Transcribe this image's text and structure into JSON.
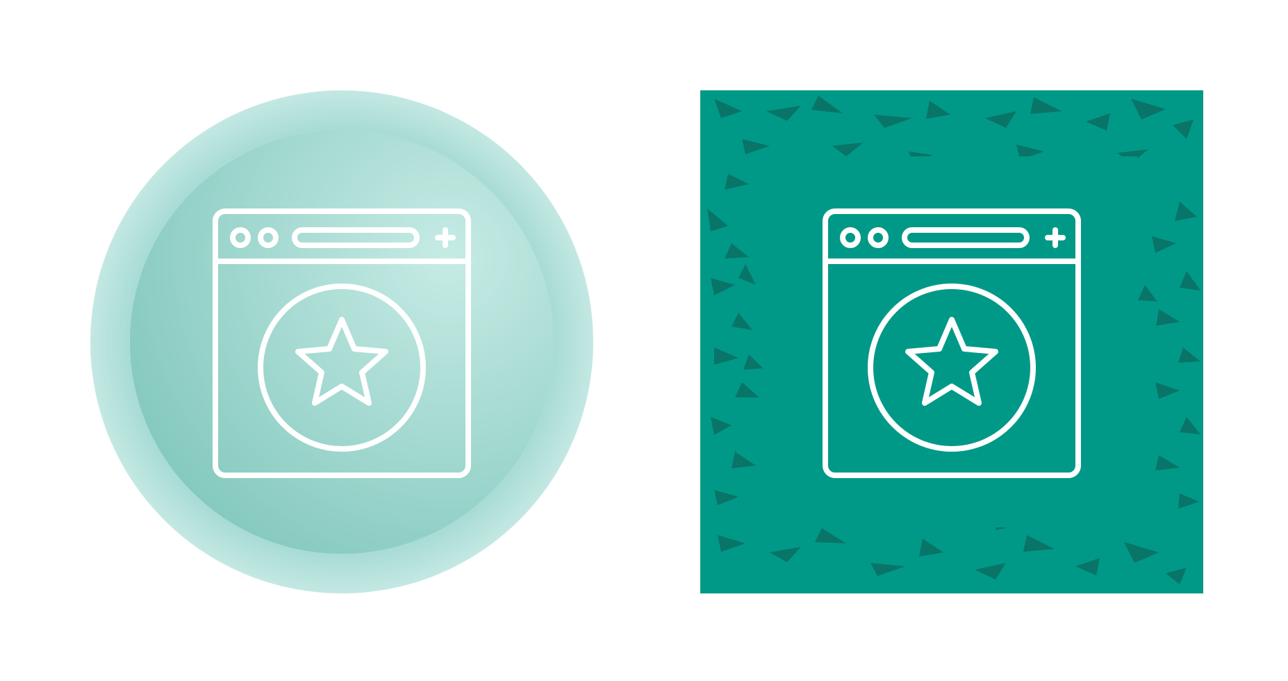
{
  "icons": [
    {
      "name": "browser-star-circle",
      "style": "circle-gradient",
      "colors": {
        "outer_ring": "#b3e0da",
        "inner_gradient_start": "#7fc6bb",
        "inner_gradient_end": "#c6ebe5",
        "line": "#ffffff"
      },
      "glyph": "browser-window-star-icon"
    },
    {
      "name": "browser-star-square",
      "style": "square-grunge",
      "colors": {
        "background": "#009987",
        "grunge": "#0b6e63",
        "line": "#ffffff"
      },
      "glyph": "browser-window-star-icon"
    }
  ]
}
